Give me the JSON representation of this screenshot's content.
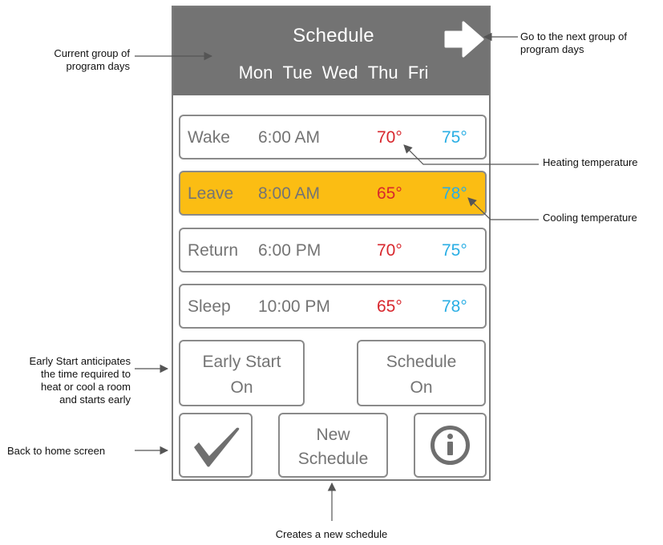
{
  "header": {
    "title": "Schedule",
    "days": [
      "Mon",
      "Tue",
      "Wed",
      "Thu",
      "Fri"
    ],
    "next_icon": "right-arrow-icon",
    "background": "#737373"
  },
  "periods": [
    {
      "name": "Wake",
      "time": "6:00 AM",
      "heat": "70°",
      "cool": "75°",
      "selected": false
    },
    {
      "name": "Leave",
      "time": "8:00 AM",
      "heat": "65°",
      "cool": "78°",
      "selected": true
    },
    {
      "name": "Return",
      "time": "6:00 PM",
      "heat": "70°",
      "cool": "75°",
      "selected": false
    },
    {
      "name": "Sleep",
      "time": "10:00 PM",
      "heat": "65°",
      "cool": "78°",
      "selected": false
    }
  ],
  "buttons": {
    "early_start": {
      "line1": "Early Start",
      "line2": "On"
    },
    "schedule": {
      "line1": "Schedule",
      "line2": "On"
    },
    "done_icon": "checkmark-icon",
    "new_schedule": {
      "line1": "New",
      "line2": "Schedule"
    },
    "info_icon": "info-icon"
  },
  "callouts": {
    "current_group": [
      "Current group of",
      "program days"
    ],
    "next_group": [
      "Go to the next group of",
      "program days"
    ],
    "heating": "Heating temperature",
    "cooling": "Cooling temperature",
    "early_start": [
      "Early Start anticipates",
      "the time required to",
      "heat or cool a room",
      "and starts early"
    ],
    "home": "Back to home screen",
    "new_schedule": "Creates a new schedule"
  },
  "colors": {
    "heat": "#d8272d",
    "cool": "#2aaee4",
    "selected_row": "#fbbd13",
    "text": "#747474"
  }
}
